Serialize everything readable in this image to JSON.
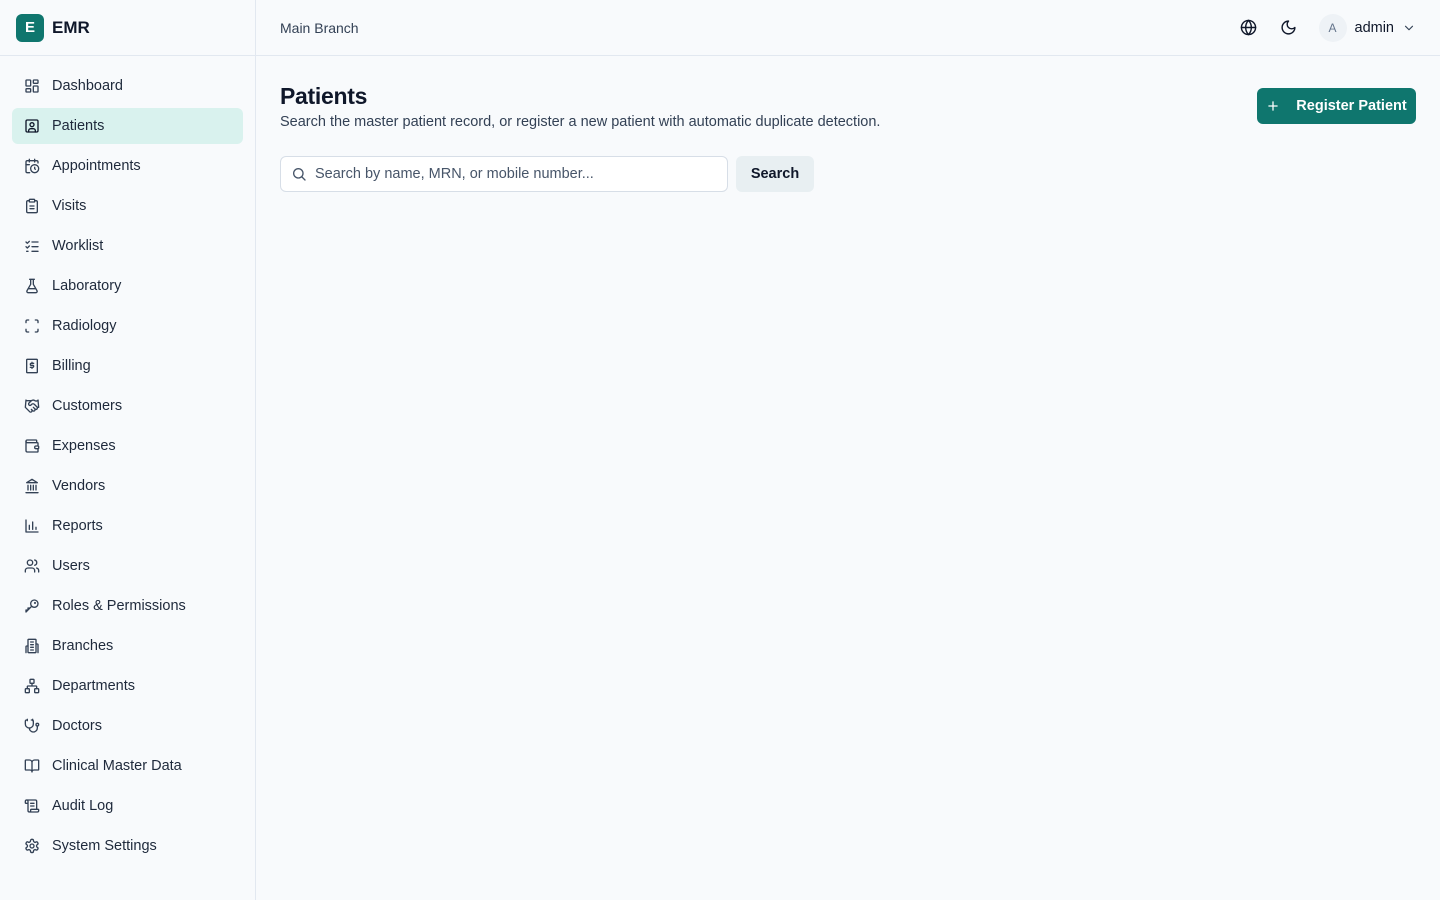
{
  "app": {
    "badge": "E",
    "name": "EMR"
  },
  "topbar": {
    "branch": "Main Branch",
    "user_initial": "A",
    "username": "admin"
  },
  "sidebar": {
    "items": [
      {
        "label": "Dashboard",
        "icon": "dashboard-icon",
        "active": false
      },
      {
        "label": "Patients",
        "icon": "patient-icon",
        "active": true
      },
      {
        "label": "Appointments",
        "icon": "calendar-clock-icon",
        "active": false
      },
      {
        "label": "Visits",
        "icon": "clipboard-icon",
        "active": false
      },
      {
        "label": "Worklist",
        "icon": "list-checks-icon",
        "active": false
      },
      {
        "label": "Laboratory",
        "icon": "flask-icon",
        "active": false
      },
      {
        "label": "Radiology",
        "icon": "scan-icon",
        "active": false
      },
      {
        "label": "Billing",
        "icon": "receipt-icon",
        "active": false
      },
      {
        "label": "Customers",
        "icon": "handshake-icon",
        "active": false
      },
      {
        "label": "Expenses",
        "icon": "wallet-icon",
        "active": false
      },
      {
        "label": "Vendors",
        "icon": "bank-icon",
        "active": false
      },
      {
        "label": "Reports",
        "icon": "bar-chart-icon",
        "active": false
      },
      {
        "label": "Users",
        "icon": "users-icon",
        "active": false
      },
      {
        "label": "Roles & Permissions",
        "icon": "key-icon",
        "active": false
      },
      {
        "label": "Branches",
        "icon": "building-icon",
        "active": false
      },
      {
        "label": "Departments",
        "icon": "network-icon",
        "active": false
      },
      {
        "label": "Doctors",
        "icon": "stethoscope-icon",
        "active": false
      },
      {
        "label": "Clinical Master Data",
        "icon": "book-icon",
        "active": false
      },
      {
        "label": "Audit Log",
        "icon": "scroll-icon",
        "active": false
      },
      {
        "label": "System Settings",
        "icon": "gear-icon",
        "active": false
      }
    ]
  },
  "main": {
    "title": "Patients",
    "subtitle": "Search the master patient record, or register a new patient with automatic duplicate detection.",
    "register_label": "Register Patient",
    "search_placeholder": "Search by name, MRN, or mobile number...",
    "search_value": "",
    "search_button": "Search"
  },
  "colors": {
    "accent": "#0f766e",
    "active_bg": "#d9f2ee",
    "background": "#f8fafc"
  }
}
